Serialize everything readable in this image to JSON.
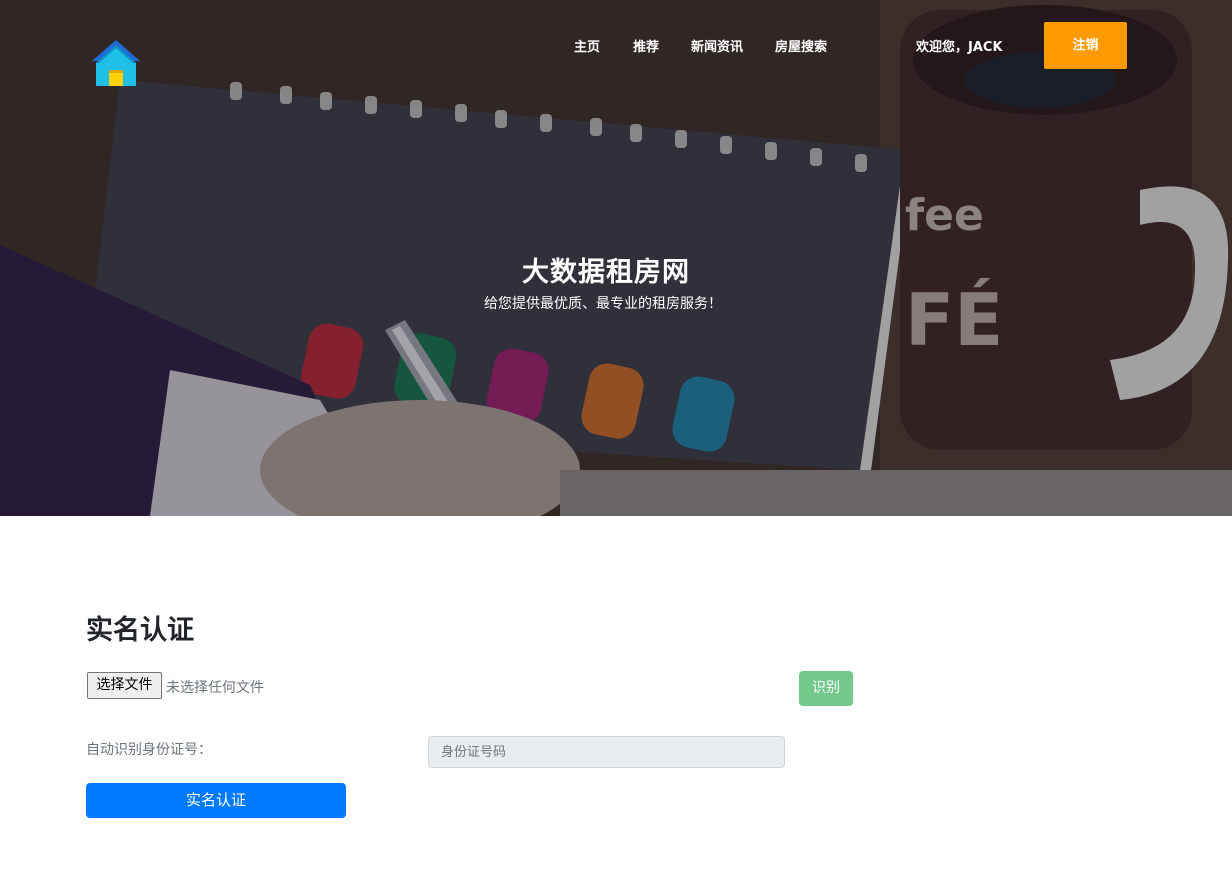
{
  "header": {
    "logo_icon": "house-icon",
    "nav": [
      {
        "label": "主页"
      },
      {
        "label": "推荐"
      },
      {
        "label": "新闻资讯"
      },
      {
        "label": "房屋搜索"
      }
    ],
    "welcome_text": "欢迎您，JACK",
    "logout_label": "注销"
  },
  "hero": {
    "title": "大数据租房网",
    "subtitle": "给您提供最优质、最专业的租房服务！"
  },
  "form": {
    "title": "实名认证",
    "file_button_label": "选择文件",
    "file_status": "未选择任何文件",
    "recognize_label": "识别",
    "id_label": "自动识别身份证号：",
    "id_placeholder": "身份证号码",
    "submit_label": "实名认证"
  },
  "colors": {
    "accent_orange": "#ff9a00",
    "primary_blue": "#007bff",
    "success_green": "#72c98b"
  }
}
